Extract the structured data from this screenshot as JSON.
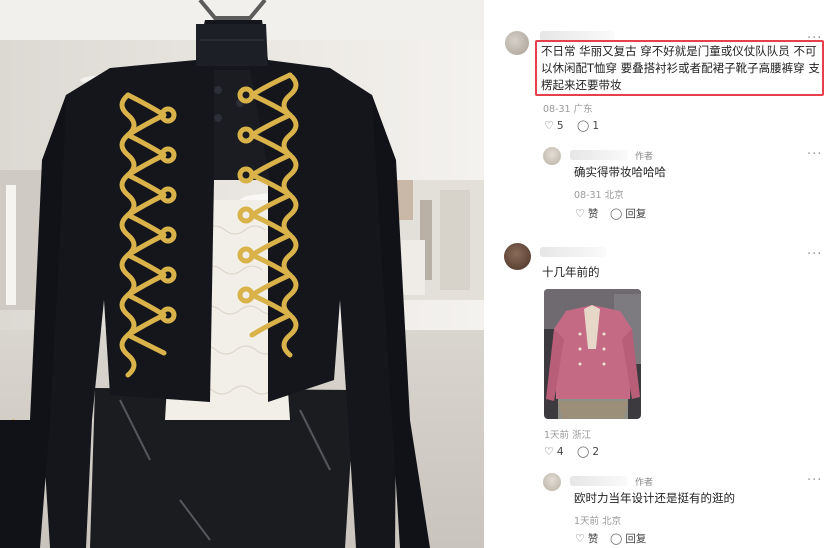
{
  "comments": [
    {
      "text_lines": [
        "不日常 华丽又复古 穿不好就是门童或仪仗队队员 不可",
        "以休闲配T恤穿 要叠搭衬衫或者配裙子靴子高腰裤穿 支",
        "楞起来还要带妆"
      ],
      "date": "08-31",
      "location": "广东",
      "likes": "5",
      "replies": "1",
      "reply": {
        "author_tag": "作者",
        "text": "确实得带妆哈哈哈",
        "date": "08-31",
        "location": "北京",
        "like_label": "赞",
        "reply_label": "回复"
      }
    },
    {
      "text": "十几年前的",
      "date": "1天前",
      "location": "浙江",
      "likes": "4",
      "replies": "2",
      "reply": {
        "author_tag": "作者",
        "text": "欧时力当年设计还是挺有的逛的",
        "date": "1天前",
        "location": "北京",
        "like_label": "赞",
        "reply_label": "回复"
      }
    }
  ],
  "more_label": "...",
  "icons": [
    "heart-icon",
    "comment-icon",
    "more-icon"
  ],
  "colors": {
    "highlight": "#e7404a",
    "meta": "#9a9a9a",
    "gold_braid": "#d9b34a",
    "jacket": "#14161c"
  }
}
